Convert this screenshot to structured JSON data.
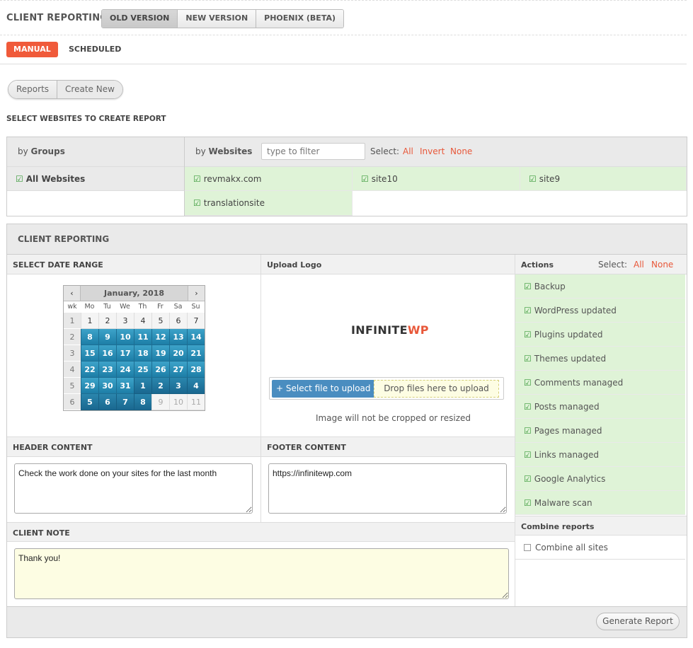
{
  "header": {
    "title": "CLIENT REPORTING",
    "version_tabs": [
      "OLD VERSION",
      "NEW VERSION",
      "PHOENIX (BETA)"
    ],
    "active_version": "OLD VERSION"
  },
  "modes": {
    "manual": "MANUAL",
    "scheduled": "SCHEDULED",
    "active": "MANUAL"
  },
  "view_toggle": {
    "reports": "Reports",
    "create_new": "Create New"
  },
  "select_websites": {
    "label": "SELECT WEBSITES TO CREATE REPORT",
    "by_groups_prefix": "by",
    "by_groups": "Groups",
    "by_websites_prefix": "by",
    "by_websites": "Websites",
    "filter_placeholder": "type to filter",
    "select_label": "Select:",
    "select_all": "All",
    "select_invert": "Invert",
    "select_none": "None",
    "groups": [
      "All Websites"
    ],
    "sites": [
      "revmakx.com",
      "site10",
      "site9",
      "translationsite"
    ]
  },
  "client_reporting": {
    "title": "CLIENT REPORTING",
    "date_range_label": "SELECT DATE RANGE",
    "calendar": {
      "month_label": "January, 2018",
      "prev": "‹",
      "next": "›",
      "headers": [
        "wk",
        "Mo",
        "Tu",
        "We",
        "Th",
        "Fr",
        "Sa",
        "Su"
      ],
      "weeks": [
        {
          "wk": "1",
          "days": [
            "1",
            "2",
            "3",
            "4",
            "5",
            "6",
            "7"
          ]
        },
        {
          "wk": "2",
          "days": [
            "8",
            "9",
            "10",
            "11",
            "12",
            "13",
            "14"
          ]
        },
        {
          "wk": "3",
          "days": [
            "15",
            "16",
            "17",
            "18",
            "19",
            "20",
            "21"
          ]
        },
        {
          "wk": "4",
          "days": [
            "22",
            "23",
            "24",
            "25",
            "26",
            "27",
            "28"
          ]
        },
        {
          "wk": "5",
          "days": [
            "29",
            "30",
            "31",
            "1",
            "2",
            "3",
            "4"
          ]
        },
        {
          "wk": "6",
          "days": [
            "5",
            "6",
            "7",
            "8",
            "9",
            "10",
            "11"
          ]
        }
      ]
    },
    "upload_logo_label": "Upload Logo",
    "logo_text_main": "INFINITE",
    "logo_text_accent": "WP",
    "select_file_button": "+ Select file to upload",
    "drop_zone": "Drop files here to upload",
    "upload_note": "Image will not be cropped or resized",
    "header_content_label": "HEADER CONTENT",
    "header_content_value": "Check the work done on your sites for the last month",
    "footer_content_label": "FOOTER CONTENT",
    "footer_content_value": "https://infinitewp.com",
    "client_note_label": "CLIENT NOTE",
    "client_note_value": "Thank you!",
    "actions_label": "Actions",
    "actions_select_label": "Select:",
    "actions_select_all": "All",
    "actions_select_none": "None",
    "actions": [
      "Backup",
      "WordPress updated",
      "Plugins updated",
      "Themes updated",
      "Comments managed",
      "Posts managed",
      "Pages managed",
      "Links managed",
      "Google Analytics",
      "Malware scan"
    ],
    "combine_label": "Combine reports",
    "combine_option": "Combine all sites",
    "generate_button": "Generate Report"
  },
  "colors": {
    "accent": "#f05a3a",
    "selected_bg": "#dff3d7",
    "calendar_selected": "#2a8ab4",
    "upload_button": "#4a8dc0"
  }
}
